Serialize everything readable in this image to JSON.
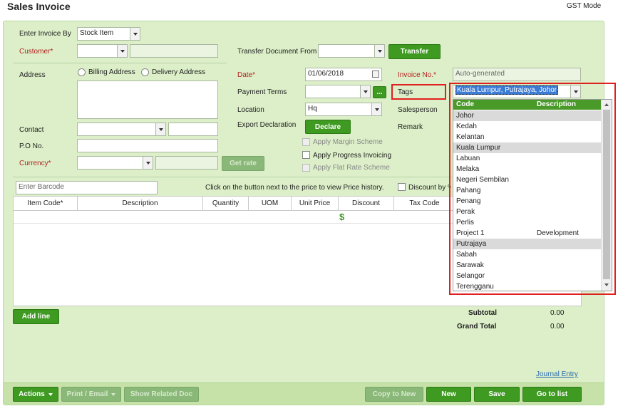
{
  "header": {
    "title": "Sales Invoice",
    "mode": "GST Mode"
  },
  "form": {
    "enter_invoice_by_label": "Enter Invoice By",
    "enter_invoice_by_value": "Stock Item",
    "customer_label": "Customer*",
    "transfer_from_label": "Transfer Document From",
    "transfer_button": "Transfer",
    "address_label": "Address",
    "billing_address_label": "Billing Address",
    "delivery_address_label": "Delivery Address",
    "contact_label": "Contact",
    "po_label": "P.O No.",
    "currency_label": "Currency*",
    "get_rate_button": "Get rate",
    "date_label": "Date*",
    "date_value": "01/06/2018",
    "payment_terms_label": "Payment Terms",
    "payment_terms_more": "...",
    "location_label": "Location",
    "location_value": "Hq",
    "export_declaration_label": "Export Declaration",
    "declare_button": "Declare",
    "apply_margin_label": "Apply Margin Scheme",
    "apply_progress_label": "Apply Progress Invoicing",
    "apply_flat_rate_label": "Apply Flat Rate Scheme",
    "invoice_no_label": "Invoice No.*",
    "invoice_no_placeholder": "Auto-generated",
    "tags_label": "Tags",
    "tags_value": "Kuala Lumpur, Putrajaya, Johor",
    "salesperson_label": "Salesperson",
    "remark_label": "Remark"
  },
  "items": {
    "barcode_placeholder": "Enter Barcode",
    "price_history_hint": "Click on the button next to the price to view Price history.",
    "discount_label": "Discount by %",
    "columns": [
      "Item Code*",
      "Description",
      "Quantity",
      "UOM",
      "Unit Price",
      "Discount",
      "Tax Code"
    ],
    "dollar_icon": "$",
    "add_line_button": "Add line"
  },
  "totals": {
    "subtotal_label": "Subtotal",
    "subtotal_value": "0.00",
    "grand_total_label": "Grand Total",
    "grand_total_value": "0.00"
  },
  "journal_entry_link": "Journal Entry",
  "footer": {
    "actions": "Actions",
    "print_email": "Print / Email",
    "show_related": "Show Related Doc",
    "copy_to_new": "Copy to New",
    "new": "New",
    "save": "Save",
    "go_to_list": "Go to list"
  },
  "tags_dropdown": {
    "code_header": "Code",
    "description_header": "Description",
    "rows": [
      {
        "code": "Johor",
        "description": "",
        "selected": true
      },
      {
        "code": "Kedah",
        "description": "",
        "selected": false
      },
      {
        "code": "Kelantan",
        "description": "",
        "selected": false
      },
      {
        "code": "Kuala Lumpur",
        "description": "",
        "selected": true
      },
      {
        "code": "Labuan",
        "description": "",
        "selected": false
      },
      {
        "code": "Melaka",
        "description": "",
        "selected": false
      },
      {
        "code": "Negeri Sembilan",
        "description": "",
        "selected": false
      },
      {
        "code": "Pahang",
        "description": "",
        "selected": false
      },
      {
        "code": "Penang",
        "description": "",
        "selected": false
      },
      {
        "code": "Perak",
        "description": "",
        "selected": false
      },
      {
        "code": "Perlis",
        "description": "",
        "selected": false
      },
      {
        "code": "Project 1",
        "description": "Development",
        "selected": false
      },
      {
        "code": "Putrajaya",
        "description": "",
        "selected": true
      },
      {
        "code": "Sabah",
        "description": "",
        "selected": false
      },
      {
        "code": "Sarawak",
        "description": "",
        "selected": false
      },
      {
        "code": "Selangor",
        "description": "",
        "selected": false
      },
      {
        "code": "Terengganu",
        "description": "",
        "selected": false
      }
    ]
  },
  "colors": {
    "panel_bg": "#dcefc8",
    "button_green": "#3e9a21",
    "highlight_red": "#e02020",
    "selection_blue": "#3a7bd5"
  }
}
